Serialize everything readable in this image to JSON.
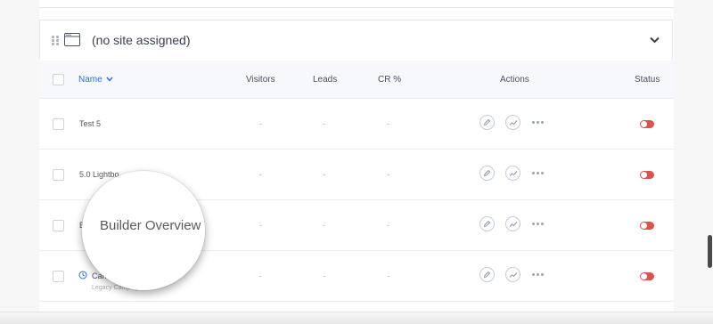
{
  "site_group": {
    "title": "(no site assigned)",
    "icons": {
      "drag": "drag-handle-icon",
      "site": "browser-window-icon",
      "collapse": "chevron-down-icon"
    }
  },
  "table": {
    "headers": {
      "name": "Name",
      "visitors": "Visitors",
      "leads": "Leads",
      "cr": "CR %",
      "actions": "Actions",
      "status": "Status"
    },
    "rows": [
      {
        "name": "Test 5",
        "visitors": "-",
        "leads": "-",
        "cr": "-",
        "status": "off"
      },
      {
        "name": "5.0 Lightbo",
        "visitors": "-",
        "leads": "-",
        "cr": "-",
        "status": "off"
      },
      {
        "name": "Bu",
        "visitors": "-",
        "leads": "-",
        "cr": "-",
        "status": "off"
      },
      {
        "name": "Canvas",
        "sub": "Legacy Campaign",
        "visitors": "-",
        "leads": "-",
        "cr": "-",
        "status": "off"
      }
    ],
    "row_actions": [
      "edit-icon",
      "analytics-icon",
      "more-icon"
    ]
  },
  "magnifier": {
    "text": "Builder Overview"
  },
  "colors": {
    "accent": "#2e6fdb",
    "toggle_off": "#d9534f",
    "header_bg": "#f6f8fc"
  }
}
